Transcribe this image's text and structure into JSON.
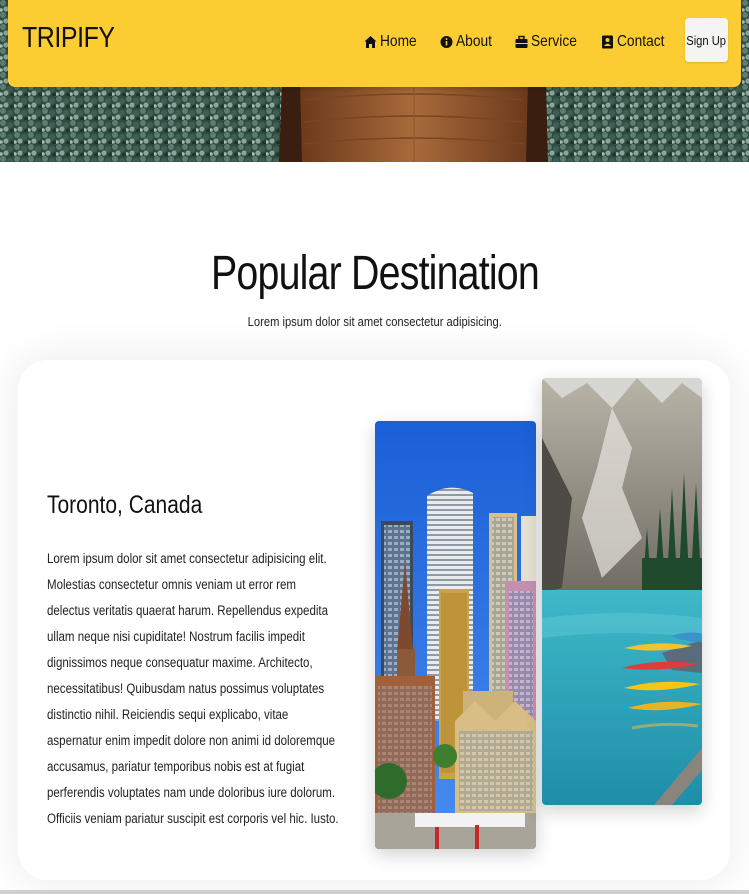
{
  "brand": {
    "name": "TRIPIFY"
  },
  "nav": {
    "items": [
      {
        "label": "Home",
        "icon": "home-icon"
      },
      {
        "label": "About",
        "icon": "info-icon"
      },
      {
        "label": "Service",
        "icon": "briefcase-icon"
      },
      {
        "label": "Contact",
        "icon": "contact-card-icon"
      }
    ],
    "signup_label": "Sign Up"
  },
  "section": {
    "title": "Popular Destination",
    "subtitle": "Lorem ipsum dolor sit amet consectetur adipisicing."
  },
  "destination": {
    "title": "Toronto, Canada",
    "description": "Lorem ipsum dolor sit amet consectetur adipisicing elit. Molestias consectetur omnis veniam ut error rem delectus veritatis quaerat harum. Repellendus expedita ullam neque nisi cupiditate! Nostrum facilis impedit dignissimos neque consequatur maxime. Architecto, necessitatibus! Quibusdam natus possimus voluptates distinctio nihil. Reiciendis sequi explicabo, vitae aspernatur enim impedit dolore non animi id doloremque accusamus, pariatur temporibus nobis est at fugiat perferendis voluptates nam unde doloribus iure dolorum. Officiis veniam pariatur suscipit est corporis vel hic. Iusto."
  },
  "colors": {
    "navbar": "#fbcd33",
    "signup_bg": "#f4f4f2",
    "text": "#111111"
  }
}
